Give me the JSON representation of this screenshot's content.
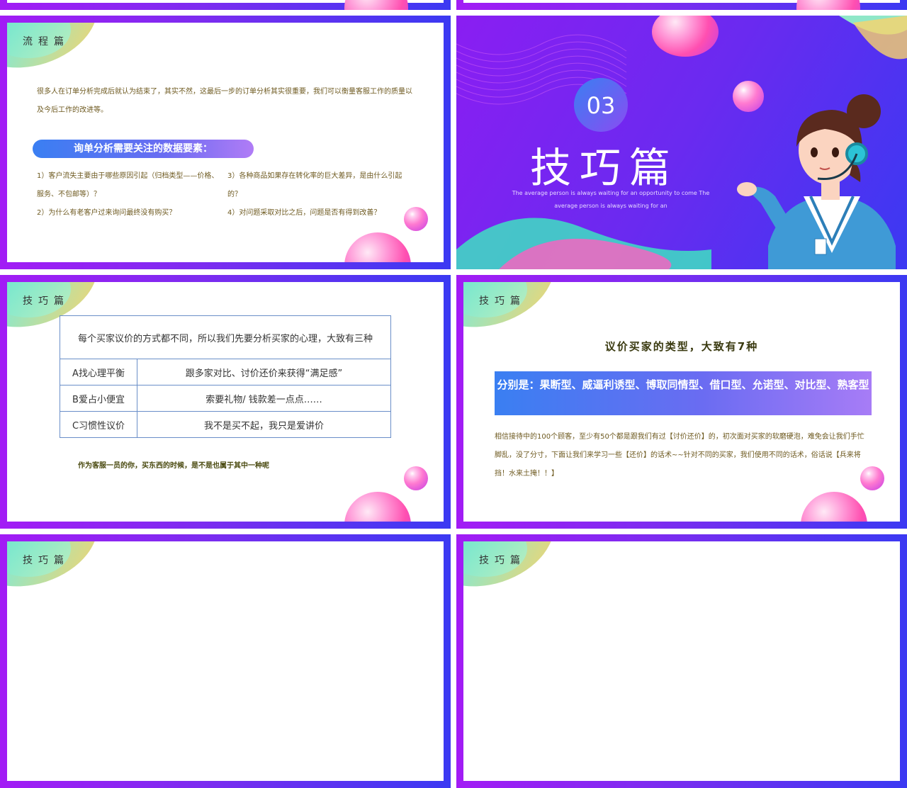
{
  "slide_flow": {
    "section_title": "流程篇",
    "intro": "很多人在订单分析完成后就认为结束了，其实不然，这最后一步的订单分析其实很重要，我们可以衡量客服工作的质量以及今后工作的改进等。",
    "pill_label": "询单分析需要关注的数据要素：",
    "questions": [
      "1）客户流失主要由于哪些原因引起（归档类型——价格、服务、不包邮等）？",
      "2）为什么有老客户过来询问最终没有购买？",
      "3）各种商品如果存在转化率的巨大差异，是由什么引起的？",
      "4）对问题采取对比之后，问题是否有得到改善？"
    ]
  },
  "slide_cover": {
    "number": "03",
    "title": "技巧篇",
    "subtitle_line1": "The average person is always waiting for an opportunity to come The",
    "subtitle_line2": "average person is always waiting for an"
  },
  "slide_table": {
    "section_title": "技巧篇",
    "table_header": "每个买家议价的方式都不同，所以我们先要分析买家的心理，大致有三种",
    "rows": [
      {
        "type": "A找心理平衡",
        "desc": "跟多家对比、讨价还价来获得“满足感”"
      },
      {
        "type": "B爱占小便宜",
        "desc": "索要礼物/ 钱款差一点点……"
      },
      {
        "type": "C习惯性议价",
        "desc": "我不是买不起，我只是爱讲价"
      }
    ],
    "note": "作为客服一员的你，买东西的时候，是不是也属于其中一种呢"
  },
  "slide_types": {
    "section_title": "技巧篇",
    "heading": "议价买家的类型，大致有7种",
    "banner": "分别是：果断型、威逼利诱型、博取同情型、借口型、允诺型、对比型、熟客型",
    "body": "相信接待中的100个顾客，至少有50个都是跟我们有过【讨价还价】的，初次面对买家的软磨硬泡，难免会让我们手忙脚乱，没了分寸，下面让我们来学习一些【还价】的话术~~针对不同的买家，我们使用不同的话术，俗话说【兵来将挡！水来土掩！！】"
  },
  "slide_bottom_left": {
    "section_title": "技巧篇"
  },
  "slide_bottom_right": {
    "section_title": "技巧篇"
  },
  "colors": {
    "frame_start": "#a21cf5",
    "frame_end": "#3b39f2",
    "accent_blue": "#3a7ff2",
    "pink": "#ff4fb0",
    "mint": "#3ee0c2"
  }
}
